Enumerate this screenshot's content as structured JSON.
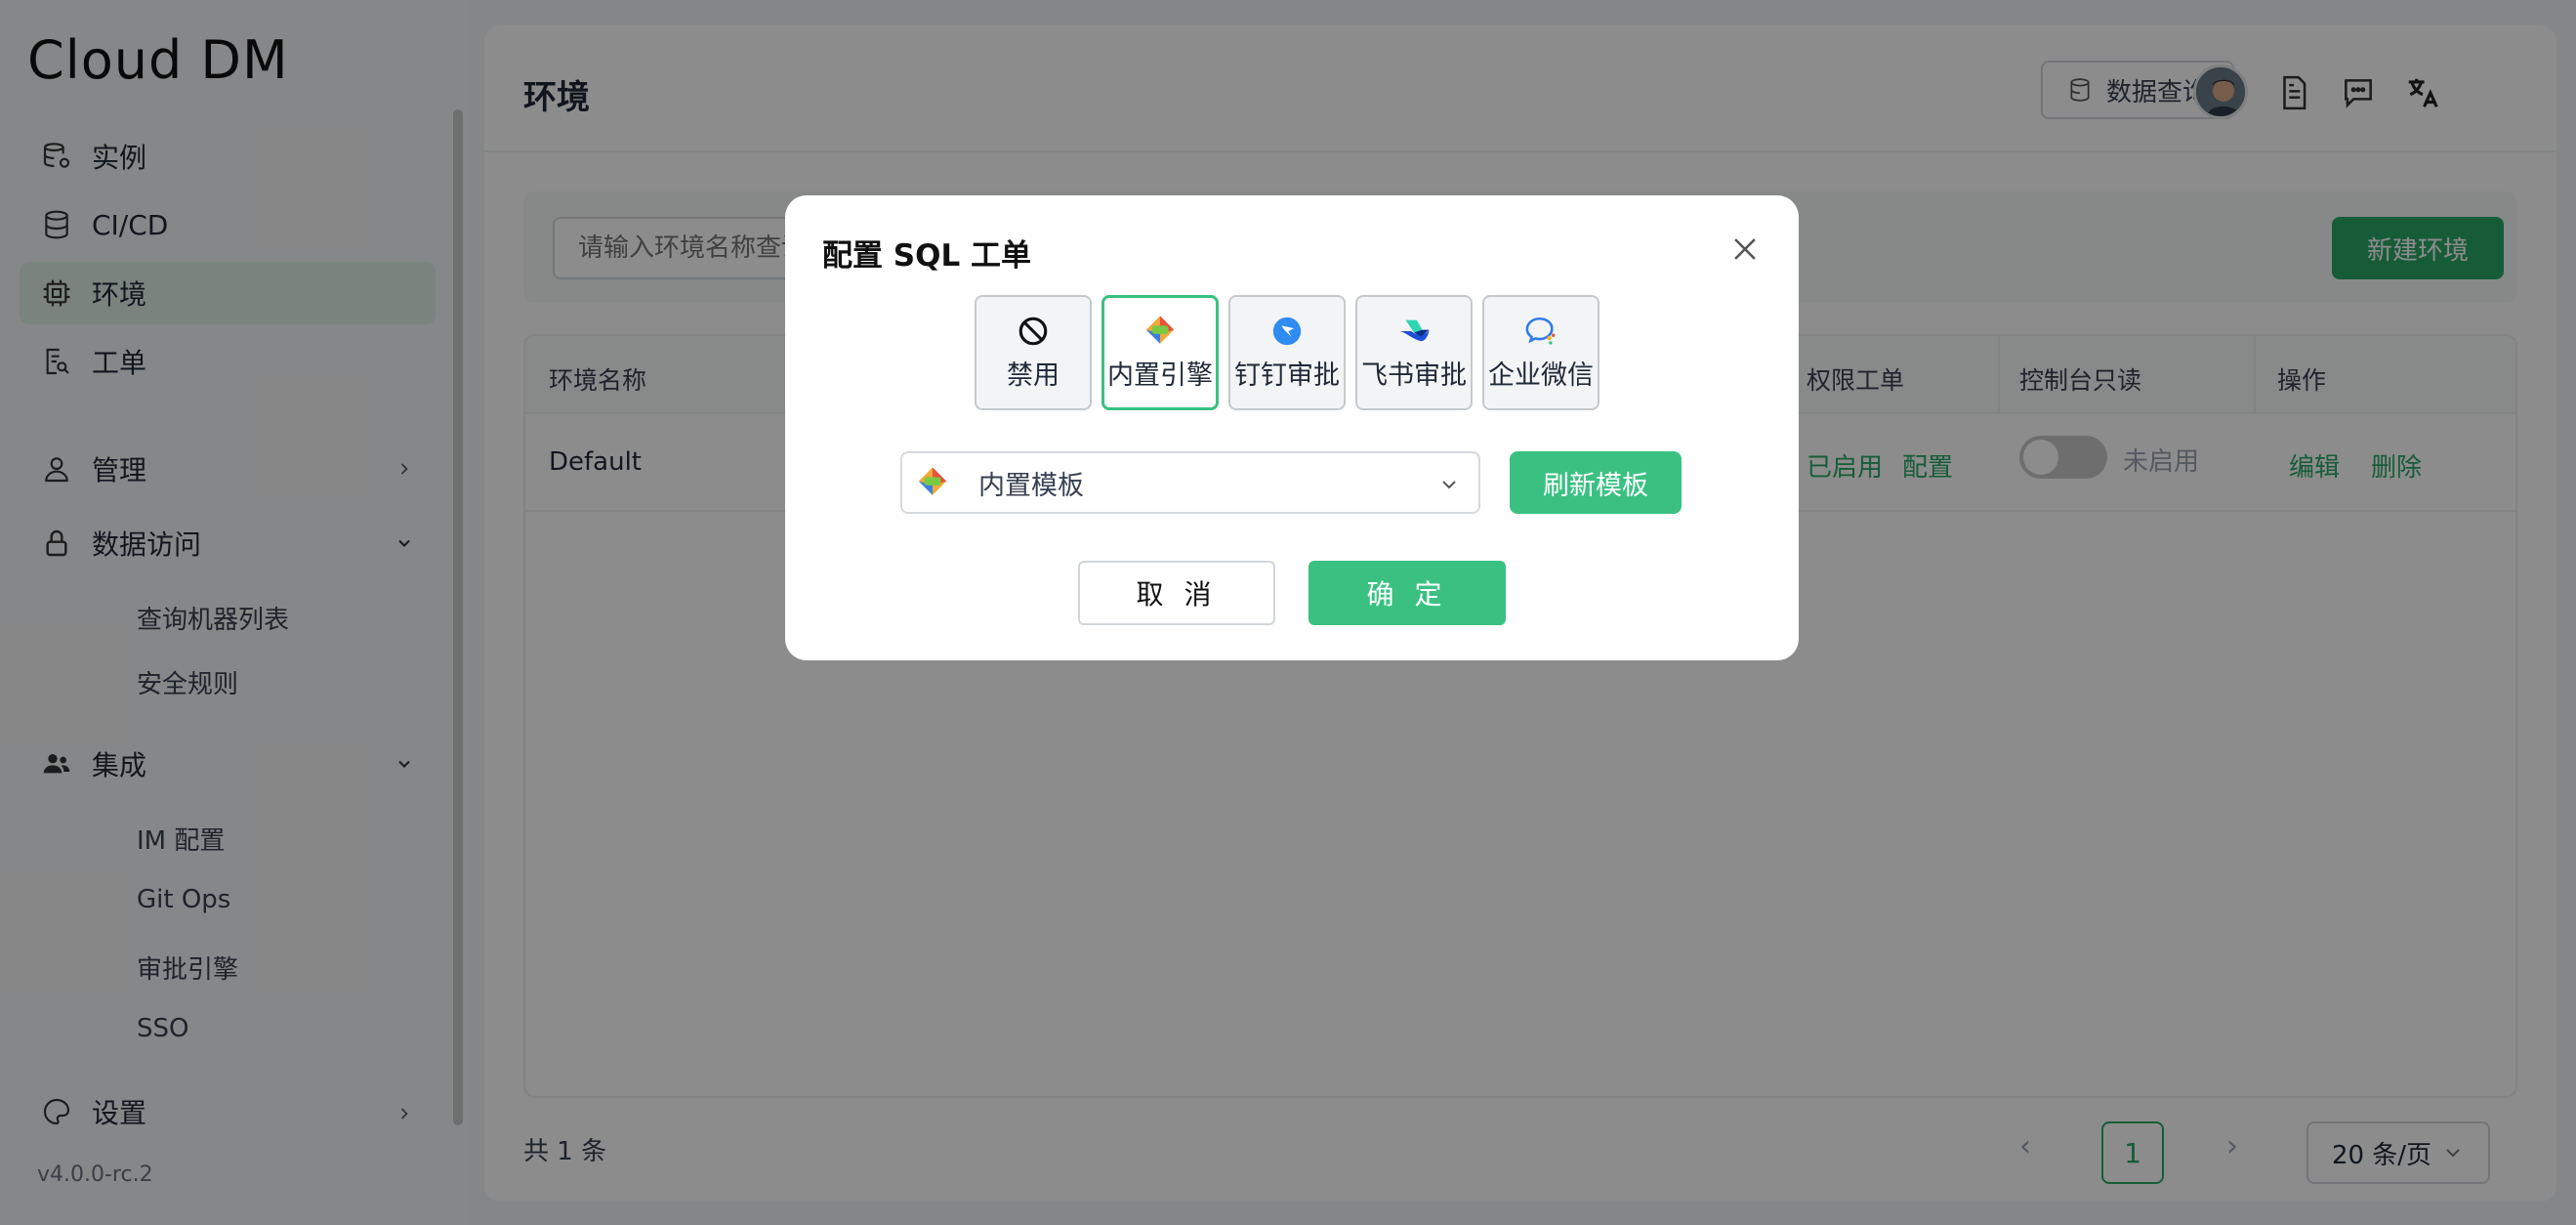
{
  "app": {
    "logo": "Cloud DM",
    "version": "v4.0.0-rc.2"
  },
  "sidebar": {
    "items": [
      {
        "label": "实例",
        "icon": "database-gear-icon"
      },
      {
        "label": "CI/CD",
        "icon": "database-icon"
      },
      {
        "label": "环境",
        "icon": "chip-icon",
        "active": true
      },
      {
        "label": "工单",
        "icon": "ticket-search-icon"
      },
      {
        "label": "管理",
        "icon": "user-icon"
      },
      {
        "label": "数据访问",
        "icon": "lock-icon"
      },
      {
        "label": "集成",
        "icon": "users-icon"
      },
      {
        "label": "设置",
        "icon": "settings-icon"
      }
    ],
    "data_access_sub": [
      "查询机器列表",
      "安全规则"
    ],
    "integration_sub": [
      "IM 配置",
      "Git Ops",
      "审批引擎",
      "SSO"
    ]
  },
  "header": {
    "title": "环境",
    "query_button": "数据查询"
  },
  "search": {
    "placeholder": "请输入环境名称查询",
    "new_button": "新建环境"
  },
  "table": {
    "columns": [
      "环境名称",
      "权限工单",
      "控制台只读",
      "操作"
    ],
    "rows": [
      {
        "name": "Default",
        "perm_status": "已启用",
        "perm_action": "配置",
        "readonly_status": "未启用",
        "edit": "编辑",
        "delete": "删除"
      }
    ]
  },
  "pagination": {
    "total": "共 1 条",
    "current": "1",
    "page_size": "20 条/页"
  },
  "modal": {
    "title": "配置 SQL 工单",
    "options": [
      {
        "label": "禁用",
        "icon": "ban-icon"
      },
      {
        "label": "内置引擎",
        "icon": "builtin-engine-icon",
        "selected": true
      },
      {
        "label": "钉钉审批",
        "icon": "dingtalk-icon"
      },
      {
        "label": "飞书审批",
        "icon": "feishu-icon"
      },
      {
        "label": "企业微信",
        "icon": "wecom-icon"
      }
    ],
    "template_select": "内置模板",
    "refresh_button": "刷新模板",
    "cancel_button": "取 消",
    "ok_button": "确 定"
  },
  "colors": {
    "accent": "#3ac182",
    "brand_green": "#2aa867"
  }
}
